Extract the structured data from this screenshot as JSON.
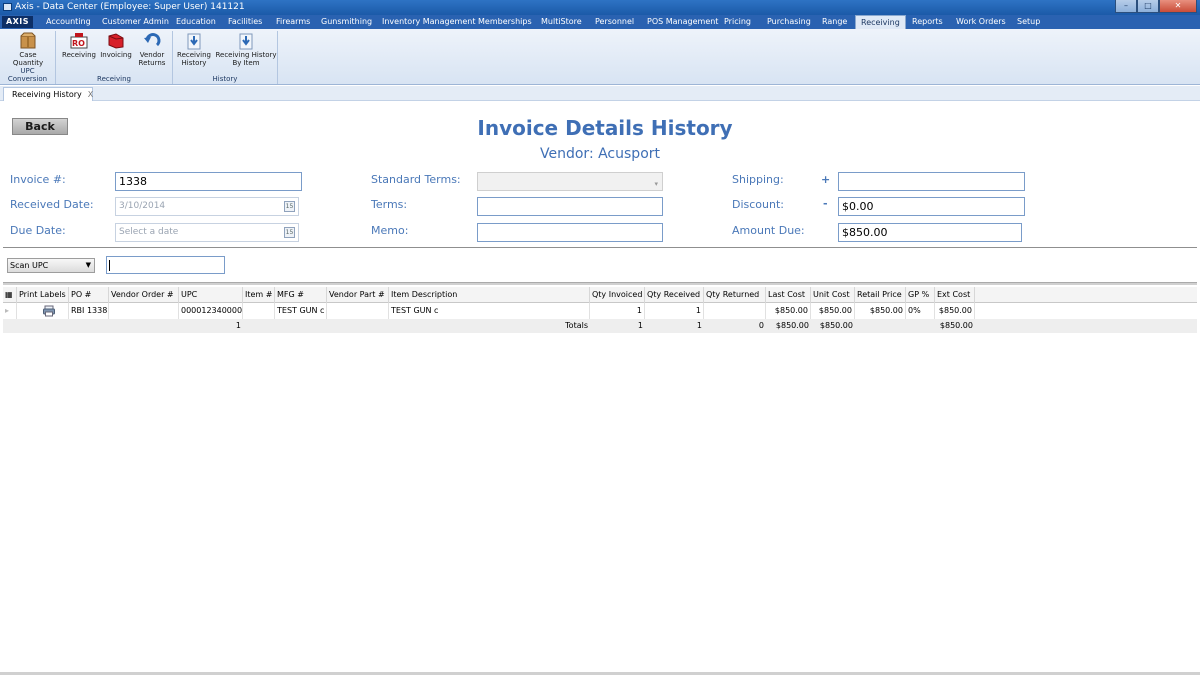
{
  "window": {
    "title": "Axis - Data Center  (Employee: Super User) 141121"
  },
  "menu": {
    "logo": "AXIS",
    "tabs": [
      "Accounting",
      "Customer Admin",
      "Education",
      "Facilities",
      "Firearms",
      "Gunsmithing",
      "Inventory Management",
      "Memberships",
      "MultiStore",
      "Personnel",
      "POS Management",
      "Pricing",
      "Purchasing",
      "Range",
      "Receiving",
      "Reports",
      "Work Orders",
      "Setup"
    ],
    "active_tab": "Receiving"
  },
  "ribbon": {
    "groups": [
      {
        "label": "UPC Conversion",
        "buttons": [
          {
            "label1": "Case",
            "label2": "Quantity",
            "icon": "box-icon"
          }
        ]
      },
      {
        "label": "Receiving",
        "buttons": [
          {
            "label1": "Receiving",
            "label2": "",
            "icon": "receiving-icon"
          },
          {
            "label1": "Invoicing",
            "label2": "",
            "icon": "invoicing-icon"
          },
          {
            "label1": "Vendor",
            "label2": "Returns",
            "icon": "return-arrow-icon"
          }
        ]
      },
      {
        "label": "History",
        "buttons": [
          {
            "label1": "Receiving",
            "label2": "History",
            "icon": "download-doc-icon"
          },
          {
            "label1": "Receiving History",
            "label2": "By Item",
            "icon": "download-doc-icon"
          }
        ]
      }
    ]
  },
  "doc_tab": {
    "label": "Receiving History",
    "close": "X"
  },
  "page": {
    "back_label": "Back",
    "title": "Invoice Details History",
    "vendor_line": "Vendor: Acusport"
  },
  "form": {
    "invoice_label": "Invoice #:",
    "invoice_value": "1338",
    "received_label": "Received Date:",
    "received_value": "3/10/2014",
    "due_label": "Due Date:",
    "due_placeholder": "Select a date",
    "standard_terms_label": "Standard Terms:",
    "standard_terms_value": "",
    "terms_label": "Terms:",
    "terms_value": "",
    "memo_label": "Memo:",
    "memo_value": "",
    "shipping_label": "Shipping:",
    "shipping_sign": "+",
    "shipping_value": "",
    "discount_label": "Discount:",
    "discount_sign": "-",
    "discount_value": "$0.00",
    "amount_due_label": "Amount Due:",
    "amount_due_value": "$850.00",
    "calendar_glyph": "15"
  },
  "scan": {
    "mode": "Scan UPC",
    "value": ""
  },
  "grid": {
    "columns": [
      "Print Labels",
      "PO #",
      "Vendor Order #",
      "UPC",
      "Item #",
      "MFG #",
      "Vendor Part #",
      "Item Description",
      "Qty Invoiced",
      "Qty Received",
      "Qty Returned",
      "Last Cost",
      "Unit Cost",
      "Retail Price",
      "GP %",
      "Ext Cost"
    ],
    "rows": [
      {
        "po": "RBI 1338",
        "vendor_order": "",
        "upc": "000012340000",
        "item": "",
        "mfg": "TEST GUN c",
        "vendor_part": "",
        "description": "TEST GUN c",
        "qty_invoiced": "1",
        "qty_received": "1",
        "qty_returned": "",
        "last_cost": "$850.00",
        "unit_cost": "$850.00",
        "retail_price": "$850.00",
        "gp": "0%",
        "ext_cost": "$850.00"
      }
    ],
    "totals": {
      "count": "1",
      "label": "Totals",
      "qty_invoiced": "1",
      "qty_received": "1",
      "qty_returned": "0",
      "last_cost": "$850.00",
      "unit_cost": "$850.00",
      "ext_cost": "$850.00"
    }
  }
}
